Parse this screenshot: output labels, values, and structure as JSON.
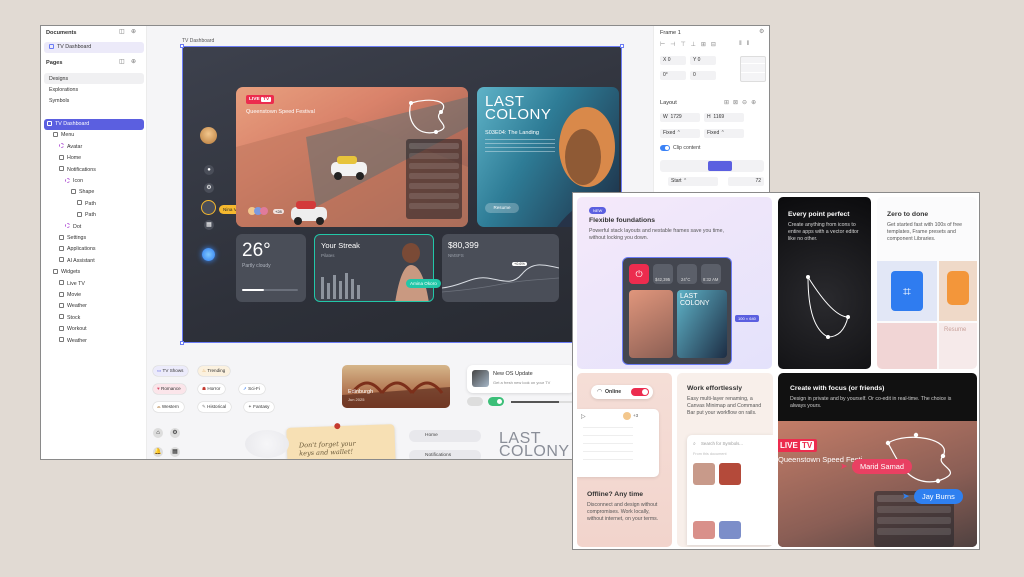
{
  "left_sidebar": {
    "documents_header": "Documents",
    "document_item": "TV Dashboard",
    "pages_header": "Pages",
    "pages": [
      "Designs",
      "Explorations",
      "Symbols"
    ],
    "layers": [
      {
        "label": "TV Dashboard",
        "depth": 0,
        "icon": "frame-icon",
        "selected": true
      },
      {
        "label": "Menu",
        "depth": 1,
        "icon": "component-icon"
      },
      {
        "label": "Avatar",
        "depth": 2,
        "icon": "instance-icon"
      },
      {
        "label": "Home",
        "depth": 2,
        "icon": "component-icon"
      },
      {
        "label": "Notifications",
        "depth": 2,
        "icon": "component-icon"
      },
      {
        "label": "Icon",
        "depth": 3,
        "icon": "instance-icon"
      },
      {
        "label": "Shape",
        "depth": 4,
        "icon": "shape-icon"
      },
      {
        "label": "Path",
        "depth": 5,
        "icon": "path-icon"
      },
      {
        "label": "Path",
        "depth": 5,
        "icon": "path-icon"
      },
      {
        "label": "Dot",
        "depth": 3,
        "icon": "instance-icon"
      },
      {
        "label": "Settings",
        "depth": 2,
        "icon": "component-icon"
      },
      {
        "label": "Applications",
        "depth": 2,
        "icon": "component-icon"
      },
      {
        "label": "AI Assistant",
        "depth": 2,
        "icon": "component-icon"
      },
      {
        "label": "Widgets",
        "depth": 1,
        "icon": "component-icon"
      },
      {
        "label": "Live TV",
        "depth": 2,
        "icon": "component-icon"
      },
      {
        "label": "Movie",
        "depth": 2,
        "icon": "component-icon"
      },
      {
        "label": "Weather",
        "depth": 2,
        "icon": "component-icon"
      },
      {
        "label": "Stock",
        "depth": 2,
        "icon": "component-icon"
      },
      {
        "label": "Workout",
        "depth": 2,
        "icon": "component-icon"
      },
      {
        "label": "Weather",
        "depth": 2,
        "icon": "component-icon"
      }
    ]
  },
  "canvas": {
    "frame_label": "TV Dashboard",
    "live_badge": "LIVE",
    "tv_badge": "TV",
    "live_title": "Queenstown Speed Festival",
    "movie_title_line1": "LAST",
    "movie_title_line2": "COLONY",
    "episode": "S03E04: The Landing",
    "resume_label": "Resume",
    "cursor_nina": "Nina Vega",
    "viewer_count": "+28",
    "weather_temp": "26°",
    "weather_desc": "Partly cloudy",
    "streak_title": "Your Streak",
    "streak_sub": "Pilates",
    "cursor_amina": "Amina Okoro",
    "stock_price": "$80,399",
    "stock_symbol": "NMSFS",
    "stock_badge": "+0.6%",
    "tags": [
      {
        "label": "TV Shows",
        "icon": "tv-icon"
      },
      {
        "label": "Trending",
        "icon": "flame-icon"
      },
      {
        "label": "Romance",
        "icon": "heart-icon"
      },
      {
        "label": "Horror",
        "icon": "ghost-icon"
      },
      {
        "label": "Sci-Fi",
        "icon": "rocket-icon"
      },
      {
        "label": "Western",
        "icon": "hat-icon"
      },
      {
        "label": "Historical",
        "icon": "scroll-icon"
      },
      {
        "label": "Fantasy",
        "icon": "wand-icon"
      }
    ],
    "location_title": "Edinburgh",
    "location_date": "Jun 2025",
    "os_title": "New OS Update",
    "os_desc": "Get a fresh new look on your TV",
    "note_text_line1": "Don't forget your",
    "note_text_line2": "keys and wallet!",
    "nav_items": [
      "Home",
      "Notifications"
    ],
    "logo_line1": "LAST",
    "logo_line2": "COLONY"
  },
  "right_sidebar": {
    "frame_name": "Frame 1",
    "layout_header": "Layout",
    "w_label": "W",
    "w_value": "1729",
    "h_label": "H",
    "h_value": "1169",
    "w_mode": "Fixed",
    "h_mode": "Fixed",
    "clip_label": "Clip content",
    "align_value": "Start",
    "gap_value": "72",
    "x_label": "X",
    "x_value": "0",
    "y_label": "Y",
    "y_value": "0",
    "rotation": "0°",
    "radius": "0"
  },
  "features": {
    "new_badge": "NEW",
    "card1_title": "Flexible foundations",
    "card1_desc": "Powerful stack layouts and nestable frames save you time, without locking you down.",
    "card1_size": "100 × 640",
    "card1_stat1": "$42,395",
    "card1_stat2": "24°C",
    "card1_stat3": "8:32 AM",
    "card2_title": "Every point perfect",
    "card2_desc": "Create anything from icons to entire apps with a vector editor like no other.",
    "card3_title": "Zero to done",
    "card3_desc": "Get started fast with 100s of free templates, Frame presets and component Libraries.",
    "card3_resume": "Resume",
    "card4_toggle_label": "Online",
    "card4_title": "Offline? Any time",
    "card4_desc": "Disconnect and design without compromises. Work locally, without internet, on your terms.",
    "card4_count": "+3",
    "card5_title": "Work effortlessly",
    "card5_desc": "Easy multi-layer renaming, a Canvas Minimap and Command Bar put your workflow on rails.",
    "card5_search": "Search for Symbols...",
    "card5_sub": "From this document",
    "card6_title": "Create with focus (or friends)",
    "card6_desc": "Design in private and by yourself. Or co-edit in real-time. The choice is always yours.",
    "card6_live": "LIVE",
    "card6_tv": "TV",
    "card6_event": "Queenstown Speed Festi...",
    "card6_cursor1": "Marid Samad",
    "card6_cursor2": "Jay Burns"
  },
  "colors": {
    "accent": "#6b7cf5",
    "live_red": "#ec2c4e",
    "cursor_yellow": "#f5b82e",
    "cursor_teal": "#22c7a8",
    "cursor_pink": "#e94062",
    "cursor_blue": "#2f80f0"
  }
}
